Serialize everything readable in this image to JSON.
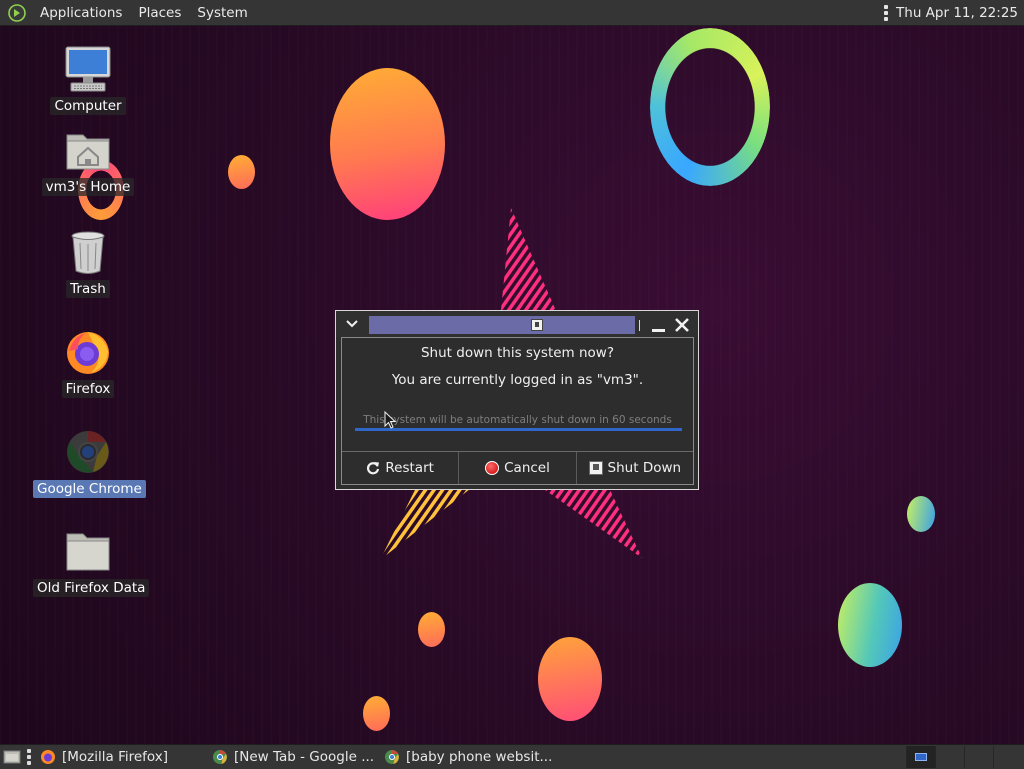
{
  "top_panel": {
    "menus": [
      "Applications",
      "Places",
      "System"
    ],
    "clock": "Thu Apr 11, 22:25",
    "logo_icon": "mate-logo-icon"
  },
  "desktop_icons": [
    {
      "label": "Computer",
      "icon": "computer-icon"
    },
    {
      "label": "vm3's Home",
      "icon": "home-folder-icon"
    },
    {
      "label": "Trash",
      "icon": "trash-icon"
    },
    {
      "label": "Firefox",
      "icon": "firefox-icon"
    },
    {
      "label": "Google Chrome",
      "icon": "chrome-icon",
      "selected": true
    },
    {
      "label": "Old Firefox Data",
      "icon": "folder-icon"
    }
  ],
  "dialog": {
    "title": "Shut down this system now?",
    "logged_in": "You are currently logged in as \"vm3\".",
    "countdown": "This system will be automatically shut down in 60 seconds",
    "progress": 1.0,
    "buttons": {
      "restart": "Restart",
      "cancel": "Cancel",
      "shutdown": "Shut Down"
    }
  },
  "taskbar": {
    "tasks": [
      {
        "label": "[Mozilla Firefox]",
        "icon": "firefox-icon"
      },
      {
        "label": "[New Tab - Google ...",
        "icon": "chrome-icon"
      },
      {
        "label": "[baby phone websit...",
        "icon": "chrome-icon"
      }
    ],
    "workspaces": 4,
    "active_workspace": 1
  },
  "colors": {
    "panel": "#353535",
    "dialog_bg": "#2d2d2d",
    "titlebar_fill": "#6b6ba8",
    "progress": "#2f66c8",
    "selection": "#5a78b4"
  }
}
